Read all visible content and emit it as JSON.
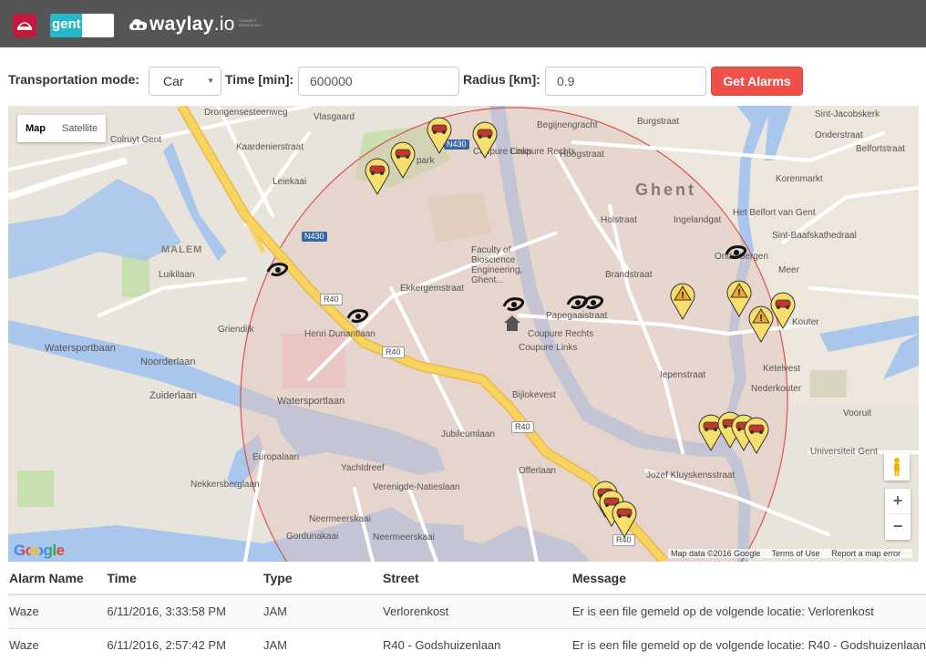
{
  "header": {
    "brand_gent": "gent",
    "brand_waylay": "waylay",
    "brand_waylay_suffix": ".io",
    "brand_waylay_tagline": "CONNECT REASON ACT"
  },
  "form": {
    "transport_label": "Transportation mode:",
    "transport_value": "Car",
    "time_label": "Time [min]:",
    "time_value": "600000",
    "radius_label": "Radius [km]:",
    "radius_value": "0.9",
    "submit_label": "Get Alarms"
  },
  "map": {
    "type_buttons": [
      "Map",
      "Satellite"
    ],
    "active_type": "Map",
    "city_label": "Ghent",
    "district_label": "MALEM",
    "place_labels": {
      "colruyt": "Colruyt Gent",
      "drongensesteenweg": "Drongensesteenweg",
      "vlasgaard": "Vlasgaard",
      "begijnengracht": "Begijnengracht",
      "burgstraat": "Burgstraat",
      "sint_jacobskerk": "Sint-Jacobskerk",
      "onderstraat": "Onderstraat",
      "belfortstraat": "Belfortstraat",
      "korenmarkt": "Korenmarkt",
      "belfort": "Het Belfort van Gent",
      "sint_baafs": "Sint-Baafskathedraal",
      "kaardenier": "Kaardenierstraat",
      "leiekaai": "Leiekaai",
      "citadelpark": "park",
      "coupure_links_top": "Coupure Links",
      "coupure_rechts_top": "Coupure Rechts",
      "hoogstraat": "Hoogstraat",
      "holstraat": "Holstraat",
      "ingelandgat": "Ingelandgat",
      "onderbergen": "Onderbergen",
      "meer": "Meer",
      "faculty": "Faculty of Bioscience Engineering, Ghent...",
      "brandstraat": "Brandstraat",
      "ekkergemstraat": "Ekkergemstraat",
      "papegaaistraat": "Papegaaistraat",
      "kouter": "Kouter",
      "henri_dunant": "Henri Dunantlaan",
      "lulkilaan": "Luikilaan",
      "watersportbaan_left": "Watersportbaan",
      "noorderlaan": "Noorderlaan",
      "zuiderlaan": "Zuiderlaan",
      "watersportlaan": "Watersportlaan",
      "coupure_rechts_mid": "Coupure Rechts",
      "coupure_links_mid": "Coupure Links",
      "bijlokevest": "Bijlokevest",
      "ketelvest": "Ketelvest",
      "ieperstraat": "Iepenstraat",
      "vooruit": "Vooruit",
      "universiteit": "Universiteit Gent",
      "jozef": "Jozef Kluyskensstraat",
      "jubileumlaan": "Jubileumlaan",
      "europalaan": "Europalaan",
      "yachtdreef": "Yachtdreef",
      "verenigde": "Verenigde-Natieslaan",
      "offerlaan": "Offerlaan",
      "nekkersberg": "Nekkersberglaan",
      "neermeerskaai1": "Neermeerskaai",
      "neermeerskaai2": "Neermeerskaai",
      "gordunakaai": "Gordunakaai",
      "grimdijk": "Griendijk",
      "nederkouter": "Nederkouter"
    },
    "road_shields": [
      "N430",
      "N430",
      "R40",
      "R40",
      "R40",
      "R40"
    ],
    "google_logo": "Google",
    "footer": {
      "map_data": "Map data ©2016 Google",
      "terms": "Terms of Use",
      "report": "Report a map error"
    },
    "zoom_in": "+",
    "zoom_out": "−",
    "search_radius_km": 0.9,
    "marker_types": [
      "car-alarm-icon",
      "warning-alarm-icon",
      "road-closed-icon",
      "home-icon"
    ]
  },
  "table": {
    "headers": [
      "Alarm Name",
      "Time",
      "Type",
      "Street",
      "Message"
    ],
    "rows": [
      [
        "Waze",
        "6/11/2016, 3:33:58 PM",
        "JAM",
        "Verlorenkost",
        "Er is een file gemeld op de volgende locatie: Verlorenkost"
      ],
      [
        "Waze",
        "6/11/2016, 2:57:42 PM",
        "JAM",
        "R40 - Godshuizenlaan",
        "Er is een file gemeld op de volgende locatie: R40 - Godshuizenlaan"
      ]
    ]
  },
  "colors": {
    "header_bg": "#555555",
    "button_red": "#f0504a",
    "radius_circle": "#d9534f",
    "water": "#a9c7ec",
    "highway": "#f8d35e"
  }
}
